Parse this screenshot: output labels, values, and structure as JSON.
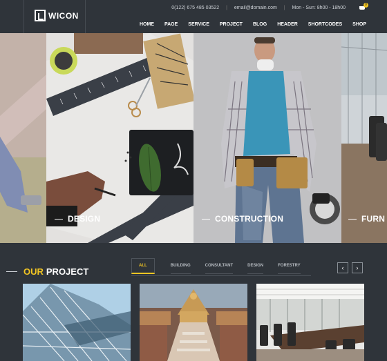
{
  "header": {
    "logo_text": "WICON",
    "phone": "0(122) 675 485 03522",
    "email": "email@domain.com",
    "hours": "Mon - Sun: 8h00 - 18h00",
    "cart_count": "0",
    "nav": [
      "HOME",
      "PAGE",
      "SERVICE",
      "PROJECT",
      "BLOG",
      "HEADER",
      "SHORTCODES",
      "SHOP"
    ]
  },
  "hero": {
    "panels": [
      "DESIGN",
      "CONSTRUCTION",
      "FURN"
    ]
  },
  "projects": {
    "title_accent": "OUR",
    "title_rest": "PROJECT",
    "tabs": [
      "ALL",
      "BUILDING",
      "CONSULTANT",
      "DESIGN",
      "FORESTRY"
    ],
    "prev": "‹",
    "next": "›"
  },
  "colors": {
    "accent": "#f3c623",
    "background": "#2f343a"
  }
}
